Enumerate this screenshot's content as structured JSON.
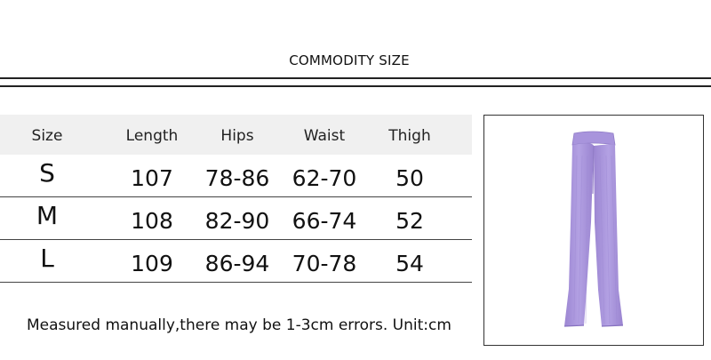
{
  "header": {
    "title": "COMMODITY SIZE"
  },
  "size_table": {
    "columns": [
      "Size",
      "Length",
      "Hips",
      "Waist",
      "Thigh"
    ],
    "rows": [
      {
        "size": "S",
        "length": "107",
        "hips": "78-86",
        "waist": "62-70",
        "thigh": "50"
      },
      {
        "size": "M",
        "length": "108",
        "hips": "82-90",
        "waist": "66-74",
        "thigh": "52"
      },
      {
        "size": "L",
        "length": "109",
        "hips": "86-94",
        "waist": "70-78",
        "thigh": "54"
      }
    ]
  },
  "footer": {
    "note": "Measured manually,there may be 1-3cm errors. Unit:cm"
  },
  "product_image": {
    "subject": "pants-icon",
    "color": "#a38fd6"
  }
}
